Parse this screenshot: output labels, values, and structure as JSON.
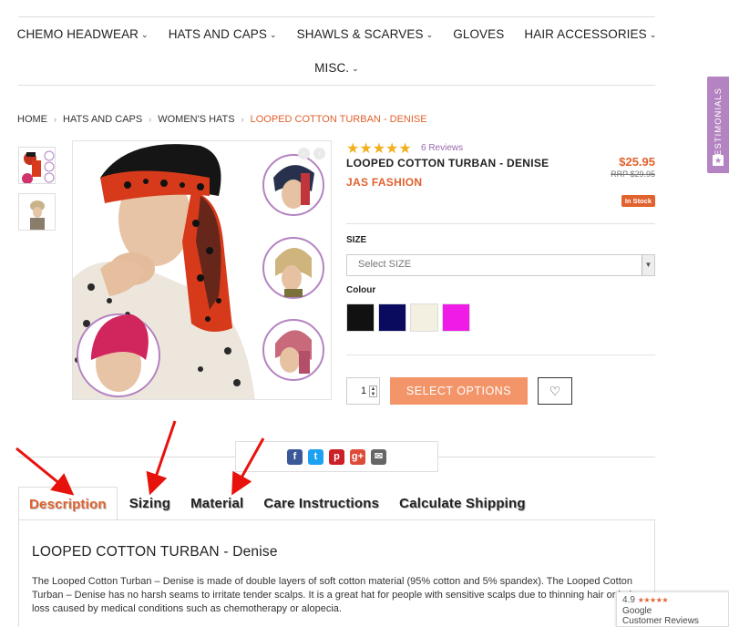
{
  "nav": {
    "items": [
      {
        "label": "CHEMO HEADWEAR",
        "has_menu": true
      },
      {
        "label": "HATS AND CAPS",
        "has_menu": true
      },
      {
        "label": "SHAWLS & SCARVES",
        "has_menu": true
      },
      {
        "label": "GLOVES",
        "has_menu": false
      },
      {
        "label": "HAIR ACCESSORIES",
        "has_menu": true
      },
      {
        "label": "MISC.",
        "has_menu": true
      }
    ],
    "chevron": "⌄"
  },
  "testimonials_label": "TESTIMONIALS",
  "breadcrumb": {
    "items": [
      "HOME",
      "HATS AND CAPS",
      "WOMEN'S HATS"
    ],
    "current": "LOOPED COTTON TURBAN - DENISE",
    "separator": "›"
  },
  "product": {
    "rating_stars": "★★★★★",
    "reviews": "6 Reviews",
    "title": "LOOPED COTTON TURBAN - DENISE",
    "brand": "JAS FASHION",
    "price": "$25.95",
    "rrp": "RRP $29.95",
    "stock": "In Stock",
    "size_label": "SIZE",
    "size_placeholder": "Select SIZE",
    "colour_label": "Colour",
    "colours": [
      "#111111",
      "#0a0a5e",
      "#f3f0e1",
      "#f01be6"
    ],
    "quantity": "1",
    "select_options": "SELECT OPTIONS"
  },
  "tabs": [
    {
      "label": "Description",
      "active": true
    },
    {
      "label": "Sizing",
      "active": false
    },
    {
      "label": "Material",
      "active": false
    },
    {
      "label": "Care Instructions",
      "active": false
    },
    {
      "label": "Calculate Shipping",
      "active": false
    }
  ],
  "description": {
    "title": "LOOPED COTTON TURBAN - Denise",
    "paragraph": "The Looped Cotton Turban – Denise is made of double layers of soft cotton material (95% cotton and 5% spandex). The Looped Cotton Turban – Denise has no harsh seams to irritate tender scalps. It is a great hat for people with sensitive scalps due to thinning hair or hair loss caused by medical conditions such as chemotherapy or alopecia."
  },
  "google_review": {
    "score": "4.9",
    "stars": "★★★★★",
    "line1": "Google",
    "line2": "Customer Reviews"
  },
  "colors": {
    "accent": "#e0622e",
    "purple": "#b483c1",
    "button": "#f39469",
    "annotation": "#e8120c"
  }
}
